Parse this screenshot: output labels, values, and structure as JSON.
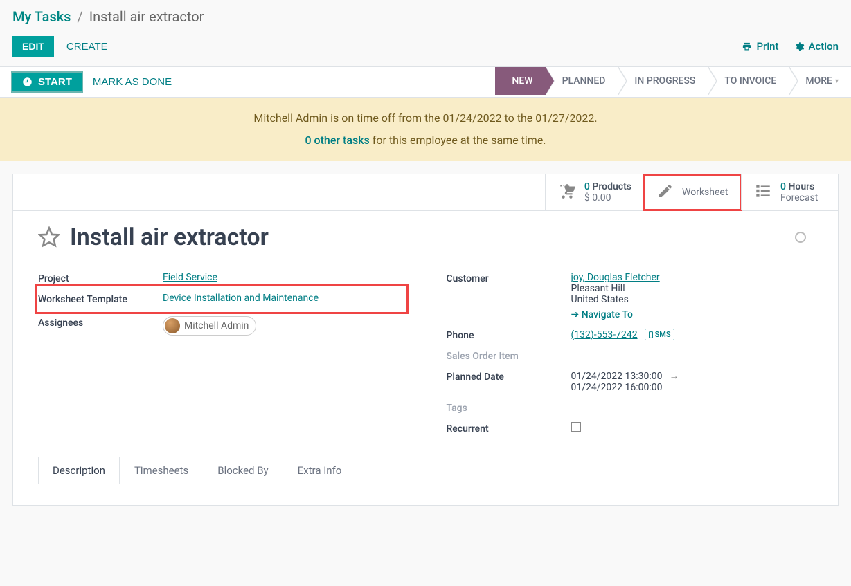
{
  "breadcrumb": {
    "root": "My Tasks",
    "current": "Install air extractor"
  },
  "toolbar": {
    "edit": "EDIT",
    "create": "CREATE",
    "print": "Print",
    "action": "Action"
  },
  "status": {
    "start": "START",
    "mark_done": "MARK AS DONE",
    "stages": [
      "NEW",
      "PLANNED",
      "IN PROGRESS",
      "TO INVOICE",
      "MORE"
    ]
  },
  "banner": {
    "line1": "Mitchell Admin is on time off from the 01/24/2022 to the 01/27/2022.",
    "link": "0 other tasks",
    "line2_rest": " for this employee at the same time."
  },
  "stats": {
    "products": {
      "line1_num": "0",
      "line1_label": " Products",
      "line2": "$ 0.00"
    },
    "worksheet": {
      "label": "Worksheet"
    },
    "hours": {
      "line1_num": "0",
      "line1_label": "  Hours",
      "line2": "Forecast"
    }
  },
  "title": "Install air extractor",
  "fields": {
    "project_label": "Project",
    "project_value": "Field Service",
    "wtpl_label": "Worksheet Template",
    "wtpl_value": "Device Installation and Maintenance",
    "assignees_label": "Assignees",
    "assignee_name": "Mitchell Admin",
    "customer_label": "Customer",
    "customer_name": "joy, Douglas Fletcher",
    "customer_city": "Pleasant Hill",
    "customer_country": "United States",
    "navigate": "Navigate To",
    "phone_label": "Phone",
    "phone_value": "(132)-553-7242",
    "sms": "SMS",
    "soitem_label": "Sales Order Item",
    "planned_label": "Planned Date",
    "planned_start": "01/24/2022 13:30:00",
    "planned_end": "01/24/2022 16:00:00",
    "tags_label": "Tags",
    "recurrent_label": "Recurrent"
  },
  "tabs": [
    "Description",
    "Timesheets",
    "Blocked By",
    "Extra Info"
  ]
}
